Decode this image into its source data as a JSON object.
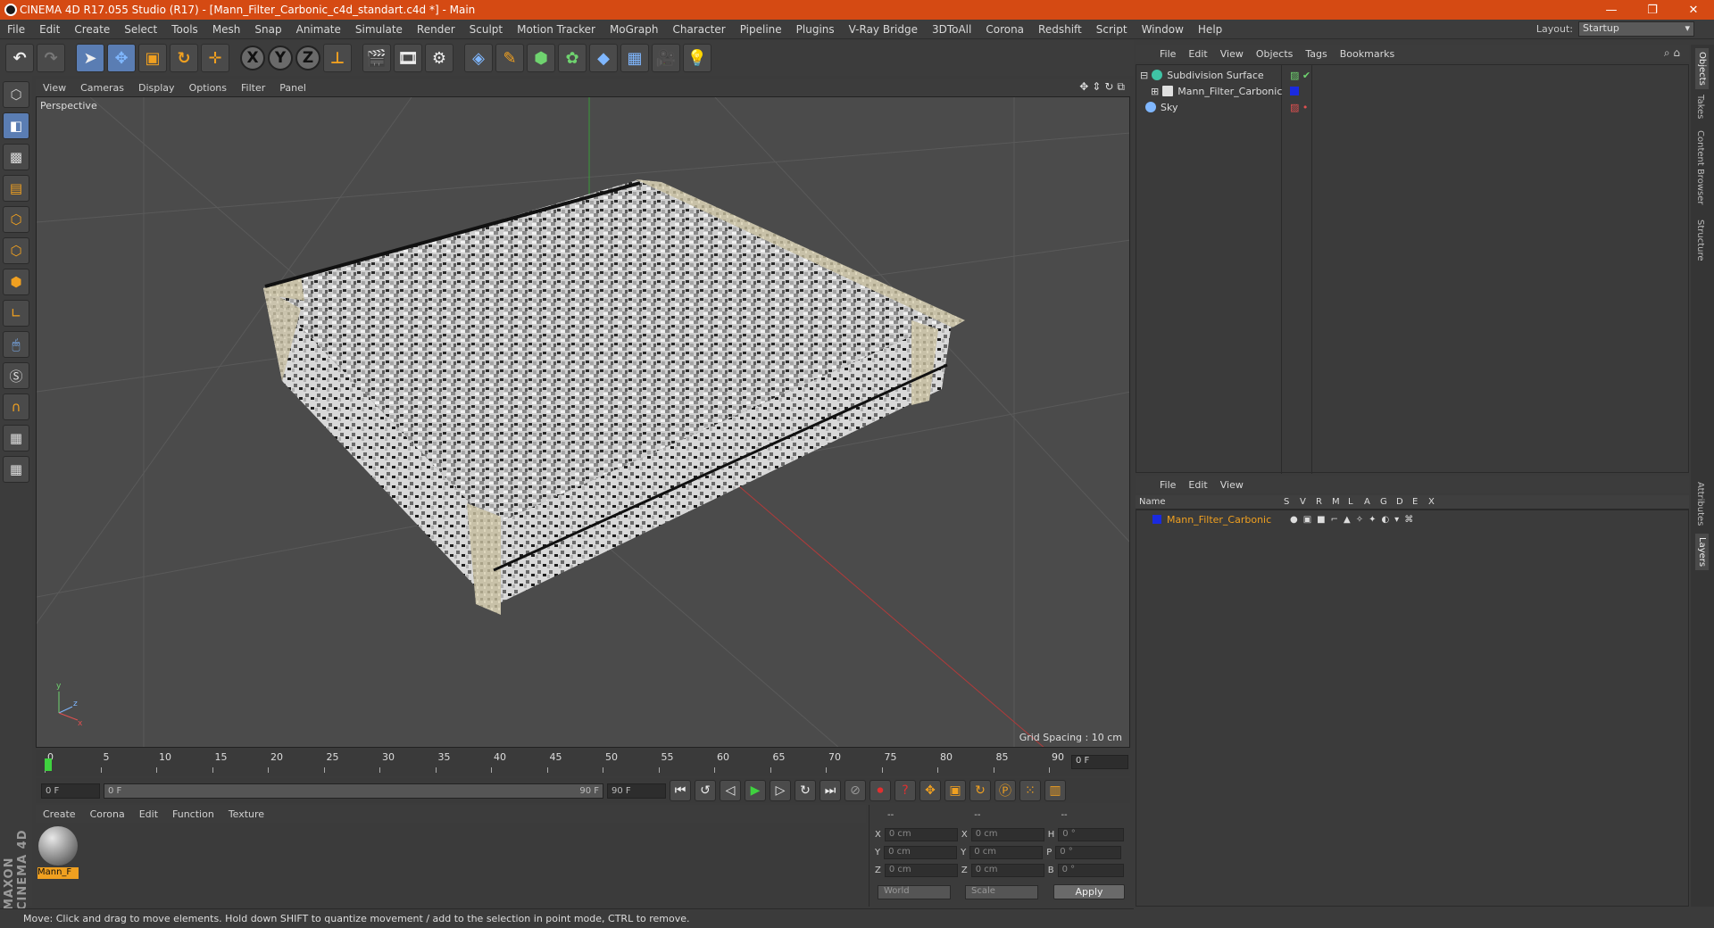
{
  "window": {
    "title": "CINEMA 4D R17.055 Studio (R17) - [Mann_Filter_Carbonic_c4d_standart.c4d *] - Main",
    "controls": [
      "—",
      "❐",
      "✕"
    ]
  },
  "menubar": {
    "items": [
      "File",
      "Edit",
      "Create",
      "Select",
      "Tools",
      "Mesh",
      "Snap",
      "Animate",
      "Simulate",
      "Render",
      "Sculpt",
      "Motion Tracker",
      "MoGraph",
      "Character",
      "Pipeline",
      "Plugins",
      "V-Ray Bridge",
      "3DToAll",
      "Corona",
      "Redshift",
      "Script",
      "Window",
      "Help"
    ],
    "layout_label": "Layout:",
    "layout_value": "Startup"
  },
  "viewport": {
    "menu": [
      "View",
      "Cameras",
      "Display",
      "Options",
      "Filter",
      "Panel"
    ],
    "label": "Perspective",
    "grid_spacing": "Grid Spacing : 10 cm"
  },
  "timeline": {
    "ticks": [
      "0",
      "5",
      "10",
      "15",
      "20",
      "25",
      "30",
      "35",
      "40",
      "45",
      "50",
      "55",
      "60",
      "65",
      "70",
      "75",
      "80",
      "85",
      "90"
    ],
    "current_frame": "0 F",
    "start_field": "0 F",
    "range_start": "0 F",
    "range_end": "90 F",
    "end_field": "90 F"
  },
  "materials": {
    "menu": [
      "Create",
      "Corona",
      "Edit",
      "Function",
      "Texture"
    ],
    "items": [
      {
        "label": "Mann_F"
      }
    ]
  },
  "coordinates": {
    "headers": [
      "--",
      "--",
      "--"
    ],
    "rows": [
      {
        "a": "X",
        "av": "0 cm",
        "b": "X",
        "bv": "0 cm",
        "c": "H",
        "cv": "0 °"
      },
      {
        "a": "Y",
        "av": "0 cm",
        "b": "Y",
        "bv": "0 cm",
        "c": "P",
        "cv": "0 °"
      },
      {
        "a": "Z",
        "av": "0 cm",
        "b": "Z",
        "bv": "0 cm",
        "c": "B",
        "cv": "0 °"
      }
    ],
    "space_dropdown": "World",
    "mode_dropdown": "Scale",
    "apply_label": "Apply"
  },
  "status": {
    "text": "Move: Click and drag to move elements. Hold down SHIFT to quantize movement / add to the selection in point mode, CTRL to remove."
  },
  "objects_panel": {
    "menu": [
      "File",
      "Edit",
      "View",
      "Objects",
      "Tags",
      "Bookmarks"
    ],
    "objects": [
      {
        "name": "Subdivision Surface",
        "icon_color": "#3fc3a5"
      },
      {
        "name": "Mann_Filter_Carbonic",
        "icon_color": "#e0e0e0"
      },
      {
        "name": "Sky",
        "icon_color": "#7fb7ff"
      }
    ]
  },
  "layers_panel": {
    "menu": [
      "File",
      "Edit",
      "View"
    ],
    "columns": [
      "Name",
      "S",
      "V",
      "R",
      "M",
      "L",
      "A",
      "G",
      "D",
      "E",
      "X"
    ],
    "layers": [
      {
        "name": "Mann_Filter_Carbonic",
        "color": "#1a2adf"
      }
    ]
  },
  "side_tabs": [
    "Objects",
    "Takes",
    "Content Browser",
    "Structure",
    "Attributes",
    "Layers"
  ],
  "logo": {
    "text": "MAXON CINEMA 4D"
  },
  "colors": {
    "accent": "#d54a13",
    "selection": "#f0a020",
    "layer_blue": "#1a2adf"
  }
}
